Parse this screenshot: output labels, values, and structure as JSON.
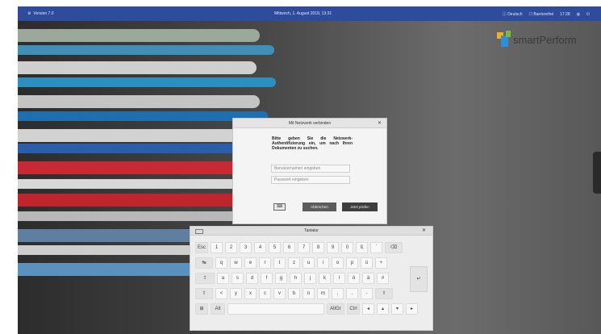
{
  "topbar": {
    "version_label": "Version 7.0",
    "datetime": "Mittwoch, 1. August 2018, 13:31",
    "language": "Deutsch",
    "accessibility": "Barrierefrei",
    "time": "17:28"
  },
  "logo": {
    "text": "smartPerform"
  },
  "login_dialog": {
    "title": "Mit Netzwerk verbinden",
    "close": "✕",
    "message": "Bitte geben Sie die Netzwerk-Authentifizierung ein, um nach Ihren Dokumenten zu suchen.",
    "username_placeholder": "Benutzernamen eingeben",
    "password_placeholder": "Passwort eingeben",
    "keyboard_button": "⌨",
    "cancel_label": "Abbrechen",
    "confirm_label": "Jetzt prüfen",
    "cancel_color": "#5c5c5c",
    "confirm_color": "#3e3e3e"
  },
  "keyboard": {
    "title": "Tastatur",
    "close": "✕",
    "row1": [
      "Esc",
      "1",
      "2",
      "3",
      "4",
      "5",
      "6",
      "7",
      "8",
      "9",
      "0",
      "ß",
      "´",
      "⌫"
    ],
    "row2": [
      "↹",
      "q",
      "w",
      "e",
      "r",
      "t",
      "z",
      "u",
      "i",
      "o",
      "p",
      "ü",
      "+"
    ],
    "row3": [
      "⇪",
      "a",
      "s",
      "d",
      "f",
      "g",
      "h",
      "j",
      "k",
      "l",
      "ö",
      "ä",
      "#"
    ],
    "row4": [
      "⇧",
      "<",
      "y",
      "x",
      "c",
      "v",
      "b",
      "n",
      "m",
      ",",
      ".",
      "-",
      "⇧"
    ],
    "row5": [
      "⊞",
      "Alt",
      "",
      "AltGr",
      "Ctrl",
      "◂",
      "▴",
      "▾",
      "▸"
    ],
    "enter": "↵"
  },
  "colors": {
    "topbar": "#2e4b9c",
    "accent": "#3a5fbf"
  },
  "background": {
    "books": [
      "#9ba89a",
      "#3f8fb8",
      "#cfcfcf",
      "#2c8fc0",
      "#c4c4c4",
      "#1f6fae",
      "#d2d2d2",
      "#2a5ea9",
      "#c72a35",
      "#d8d8d8",
      "#c0242c",
      "#b8b8b8",
      "#5e7fa0",
      "#cdcdcd",
      "#5a91bf"
    ]
  }
}
